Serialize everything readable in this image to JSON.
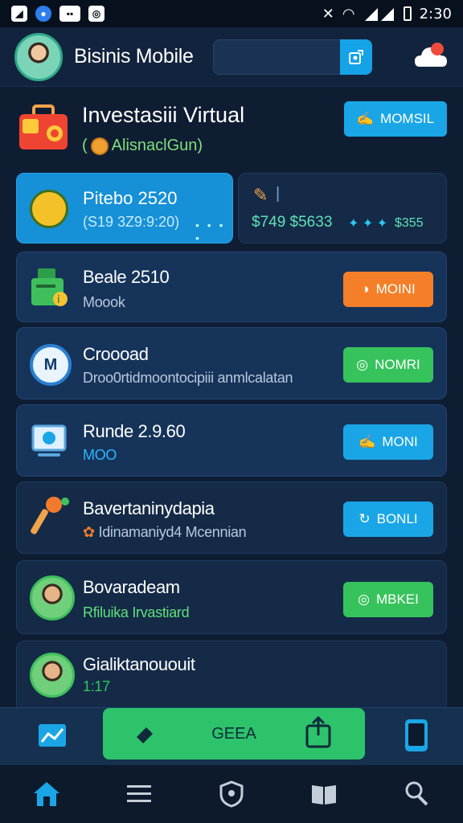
{
  "status_bar": {
    "time": "2:30",
    "icons": [
      "app-icon-a",
      "messenger-icon",
      "media-icon",
      "notification-icon",
      "mute-icon",
      "wifi-icon",
      "signal-icon",
      "battery-icon"
    ]
  },
  "header": {
    "avatar": "user-avatar",
    "title": "Bisinis Mobile",
    "search": {
      "value": "",
      "placeholder": ""
    },
    "search_icon": "search-icon",
    "cloud_icon": "cloud-alert-icon"
  },
  "hero": {
    "title": "Investasiii Virtual",
    "subtitle": "AlisnaclGun)",
    "icon": "briefcase-icon",
    "button_label": "MOMSIL"
  },
  "summary": {
    "left": {
      "title": "Pitebo 2520",
      "value": "(S19 3Z9:9:20)",
      "icon": "coin-icon"
    },
    "right": {
      "top": "|",
      "value": "$749 $5633",
      "extra": "$355",
      "icon": "clip-icon"
    }
  },
  "rows": [
    {
      "title": "Beale 2510",
      "subtitle": "Moook",
      "icon": "cash-register-icon",
      "button": "MOINI",
      "button_color": "orange"
    },
    {
      "title": "Croooad",
      "subtitle": "Droo0rtidmoontocipiii anmlcalatan",
      "icon": "mastercard-icon",
      "button": "NOMRI",
      "button_color": "green"
    },
    {
      "title": "Runde 2.9.60",
      "subtitle": "MOO",
      "icon": "monitor-icon",
      "button": "MONI",
      "button_color": "blue"
    },
    {
      "title": "Bavertaninydapia",
      "subtitle": "Idinamaniyd4 Mcennian",
      "icon": "wrench-icon",
      "button": "BONLI",
      "button_color": "blue"
    },
    {
      "title": "Bovaradeam",
      "subtitle": "Rfiluika Irvastiard",
      "icon": "user-avatar",
      "button": "MBKEI",
      "button_color": "green"
    },
    {
      "title": "Gialiktanououit",
      "subtitle": "1:17",
      "icon": "user-avatar"
    }
  ],
  "bottom_bar": {
    "left_icon": "folder-chart-icon",
    "action_label": "GEEA",
    "right_icon": "phone-icon"
  },
  "nav": [
    {
      "icon": "home-icon",
      "active": true
    },
    {
      "icon": "list-icon",
      "active": false
    },
    {
      "icon": "shield-icon",
      "active": false
    },
    {
      "icon": "book-icon",
      "active": false
    },
    {
      "icon": "search-user-icon",
      "active": false
    }
  ],
  "colors": {
    "background": "#0f1d33",
    "accent_blue": "#1aa6e6",
    "accent_orange": "#f47f28",
    "accent_green": "#37c35c"
  }
}
